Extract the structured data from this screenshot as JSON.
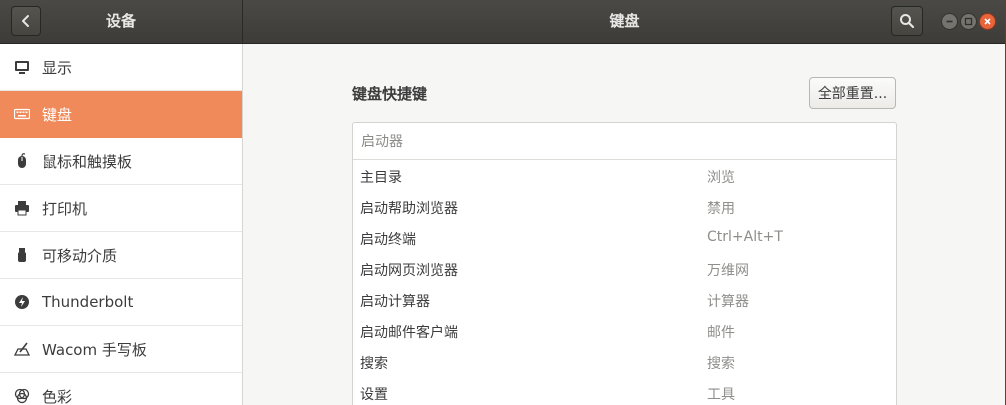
{
  "header": {
    "sidebar_title": "设备",
    "main_title": "键盘"
  },
  "sidebar": {
    "items": [
      {
        "label": "显示",
        "icon": "display-icon"
      },
      {
        "label": "键盘",
        "icon": "keyboard-icon",
        "active": true
      },
      {
        "label": "鼠标和触摸板",
        "icon": "mouse-icon"
      },
      {
        "label": "打印机",
        "icon": "printer-icon"
      },
      {
        "label": "可移动介质",
        "icon": "removable-media-icon"
      },
      {
        "label": "Thunderbolt",
        "icon": "thunderbolt-icon"
      },
      {
        "label": "Wacom 手写板",
        "icon": "tablet-icon"
      },
      {
        "label": "色彩",
        "icon": "color-icon"
      }
    ]
  },
  "content": {
    "section_title": "键盘快捷键",
    "reset_label": "全部重置...",
    "group_header": "启动器",
    "shortcuts": [
      {
        "name": "主目录",
        "accel": "浏览"
      },
      {
        "name": "启动帮助浏览器",
        "accel": "禁用"
      },
      {
        "name": "启动终端",
        "accel": "Ctrl+Alt+T"
      },
      {
        "name": "启动网页浏览器",
        "accel": "万维网"
      },
      {
        "name": "启动计算器",
        "accel": "计算器"
      },
      {
        "name": "启动邮件客户端",
        "accel": "邮件"
      },
      {
        "name": "搜索",
        "accel": "搜索"
      },
      {
        "name": "设置",
        "accel": "工具"
      }
    ]
  },
  "colors": {
    "accent": "#f08a5a",
    "headerbar": "#3d3c38",
    "close_button": "#e8643a"
  }
}
